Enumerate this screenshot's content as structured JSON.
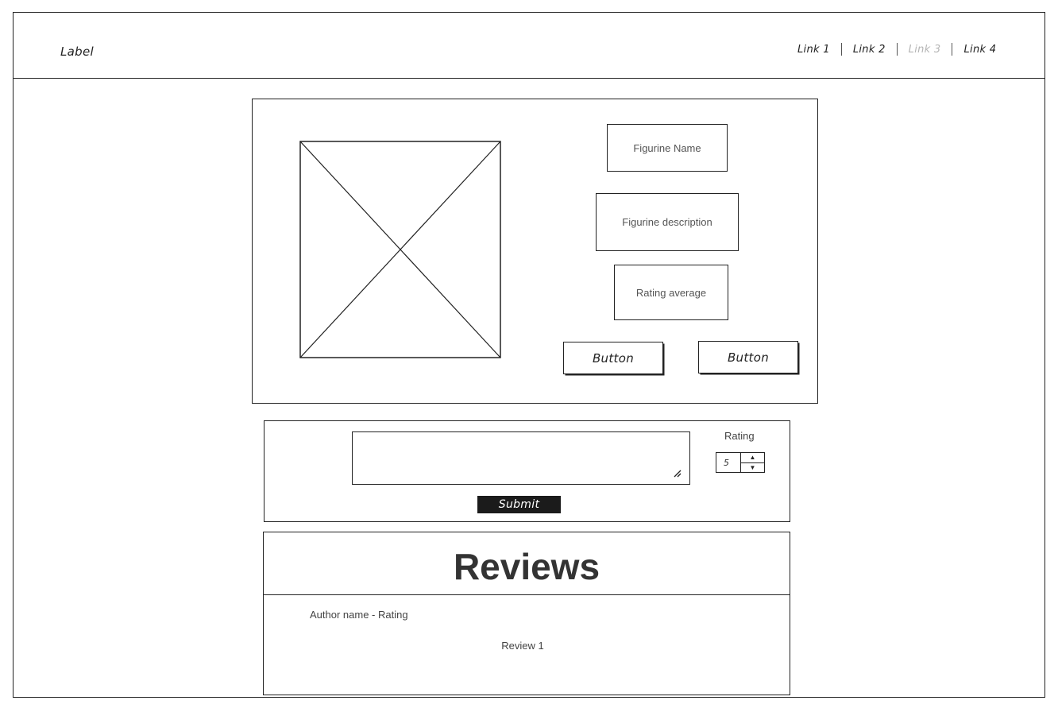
{
  "header": {
    "label": "Label",
    "nav_links": [
      {
        "label": "Link 1",
        "disabled": false
      },
      {
        "label": "Link 2",
        "disabled": false
      },
      {
        "label": "Link 3",
        "disabled": true
      },
      {
        "label": "Link 4",
        "disabled": false
      }
    ]
  },
  "product": {
    "name": "Figurine Name",
    "description": "Figurine description",
    "rating_average": "Rating average",
    "buttons": [
      "Button",
      "Button"
    ]
  },
  "review_form": {
    "textarea_value": "",
    "rating_label": "Rating",
    "rating_value": "5",
    "submit_label": "Submit"
  },
  "reviews": {
    "title": "Reviews",
    "items": [
      {
        "author_rating": "Author name - Rating",
        "text": "Review 1"
      }
    ]
  }
}
